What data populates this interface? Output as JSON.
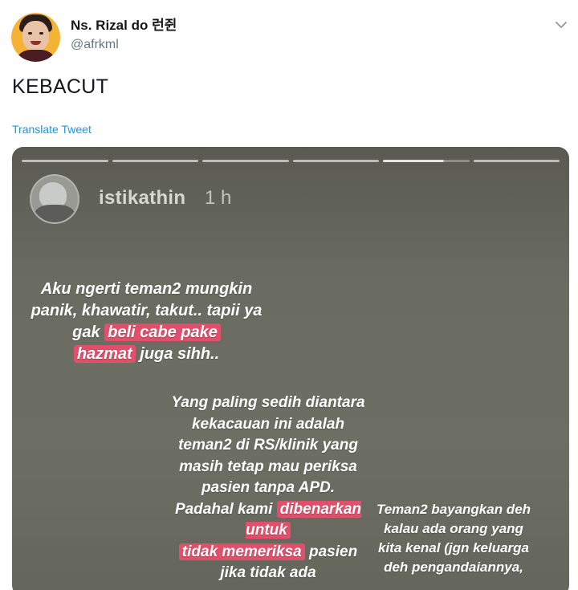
{
  "user": {
    "display_name": "Ns. Rizal do 런쥔",
    "handle": "@afrkml"
  },
  "tweet": {
    "text": "KEBACUT",
    "translate_label": "Translate Tweet"
  },
  "story": {
    "username": "istikathin",
    "time": "1 h",
    "progress_segments": 6,
    "caption1": {
      "before": "Aku ngerti teman2 mungkin panik, khawatir, takut.. tapii ya gak ",
      "hl1": "beli cabe pake",
      "hl2": "hazmat",
      "after": " juga sihh.."
    },
    "caption2": {
      "before": "Yang paling sedih diantara kekacauan ini adalah teman2 di RS/klinik yang masih tetap mau periksa pasien tanpa APD. Padahal kami ",
      "hl1": "dibenarkan untuk",
      "hl2": "tidak memeriksa",
      "after": " pasien jika tidak ada"
    },
    "caption3": "Teman2 bayangkan deh kalau ada orang yang kita kenal (jgn keluarga deh pengandaiannya,"
  },
  "colors": {
    "link": "#1b95e0",
    "secondary_text": "#657786",
    "highlight": "#e0506a"
  }
}
